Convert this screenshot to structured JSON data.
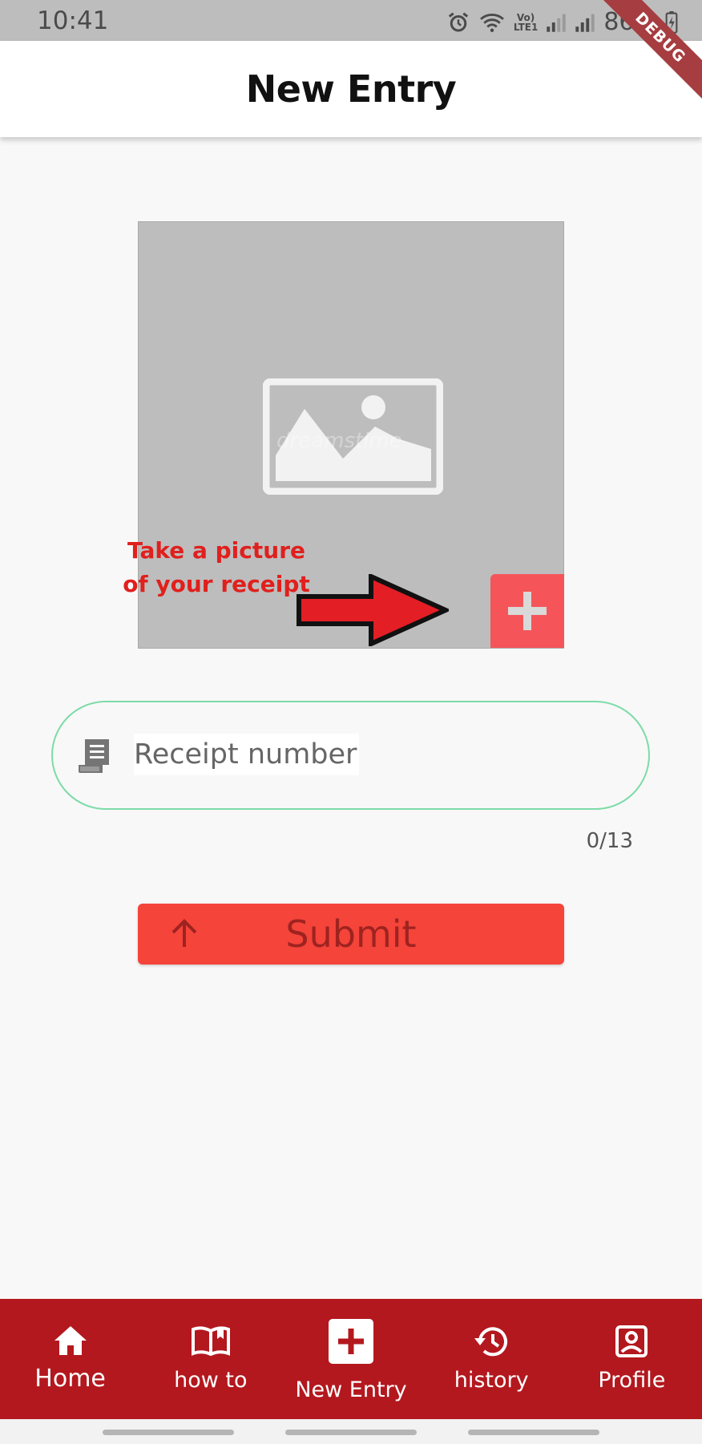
{
  "status_bar": {
    "time": "10:41",
    "battery": "86%",
    "lte_top": "Vo)",
    "lte_bottom": "LTE1",
    "icons": [
      "alarm-icon",
      "wifi-icon",
      "signal-icon",
      "signal-icon",
      "battery-charging-icon"
    ]
  },
  "debug_banner": "DEBUG",
  "app_bar": {
    "title": "New Entry"
  },
  "photo": {
    "placeholder_icon": "image-placeholder-icon",
    "watermark": "dreamstime",
    "hint": "Take a picture of your receipt",
    "add_button_icon": "plus-icon"
  },
  "receipt": {
    "placeholder": "Receipt number",
    "value": "",
    "counter": "0/13",
    "icon": "receipt-icon"
  },
  "submit": {
    "label": "Submit",
    "icon": "arrow-up-icon"
  },
  "bottom_nav": {
    "items": [
      {
        "label": "Home",
        "icon": "home-icon"
      },
      {
        "label": "how to",
        "icon": "book-icon"
      },
      {
        "label": "New Entry",
        "icon": "add-box-icon"
      },
      {
        "label": "history",
        "icon": "history-icon"
      },
      {
        "label": "Profile",
        "icon": "profile-icon"
      }
    ]
  },
  "colors": {
    "nav_background": "#b3181e",
    "submit_background": "#f5443a",
    "add_button": "#f55559",
    "hint_text": "#e0201d",
    "input_border": "#7ddba8"
  }
}
